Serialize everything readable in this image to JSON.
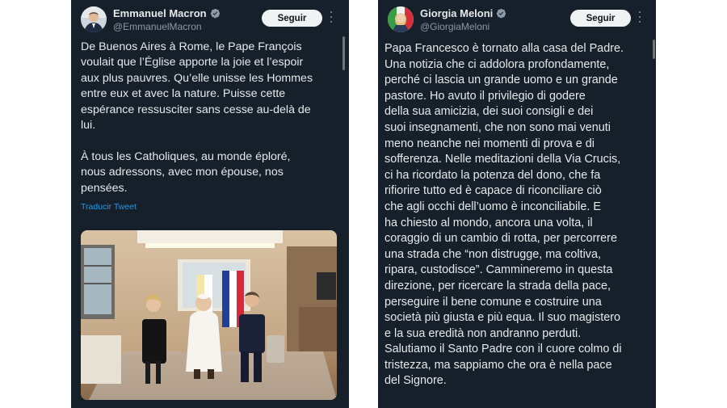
{
  "colors": {
    "background": "#15202b",
    "text": "#e7e9ea",
    "secondary": "#8b98a5",
    "link": "#1d9bf0",
    "button": "#eff3f4"
  },
  "left_tweet": {
    "display_name": "Emmanuel Macron",
    "handle": "@EmmanuelMacron",
    "follow_label": "Seguir",
    "text": "De Buenos Aires à Rome, le Pape François\nvoulait que l’Église apporte la joie et l’espoir\naux plus pauvres. Qu’elle unisse les Hommes\nentre eux et avec la nature. Puisse cette\nespérance ressusciter sans cesse au-delà de\nlui.\n\nÀ tous les Catholiques, au monde éploré,\nnous adressons, avec mon épouse, nos\npensées.",
    "translate_label": "Traducir Tweet",
    "icons": {
      "verified": "verified-badge-icon",
      "more": "more-options-icon"
    }
  },
  "right_tweet": {
    "display_name": "Giorgia Meloni",
    "handle": "@GiorgiaMeloni",
    "follow_label": "Seguir",
    "text": "Papa Francesco è tornato alla casa del Padre.\nUna notizia che ci addolora profondamente,\nperché ci lascia un grande uomo e un grande\npastore. Ho avuto il privilegio di godere\ndella sua amicizia, dei suoi consigli e dei\nsuoi insegnamenti, che non sono mai venuti\nmeno neanche nei momenti di prova e di\nsofferenza. Nelle meditazioni della Via Crucis,\nci ha ricordato la potenza del dono, che fa\nrifiorire tutto ed è capace di riconciliare ciò\nche agli occhi dell’uomo è inconciliabile. E\nha chiesto al mondo, ancora una volta, il\ncoraggio di un cambio di rotta, per percorrere\nuna strada che “non distrugge, ma coltiva,\nripara, custodisce”. Cammineremo in questa\ndirezione, per ricercare la strada della pace,\nperseguire il bene comune e costruire una\nsocietà più giusta e più equa. Il suo magistero\ne la sua eredità non andranno perduti.\nSalutiamo il Santo Padre con il cuore colmo di\ntristezza, ma sappiamo che ora è nella pace\ndel Signore.",
    "icons": {
      "verified": "verified-badge-icon",
      "more": "more-options-icon"
    }
  }
}
